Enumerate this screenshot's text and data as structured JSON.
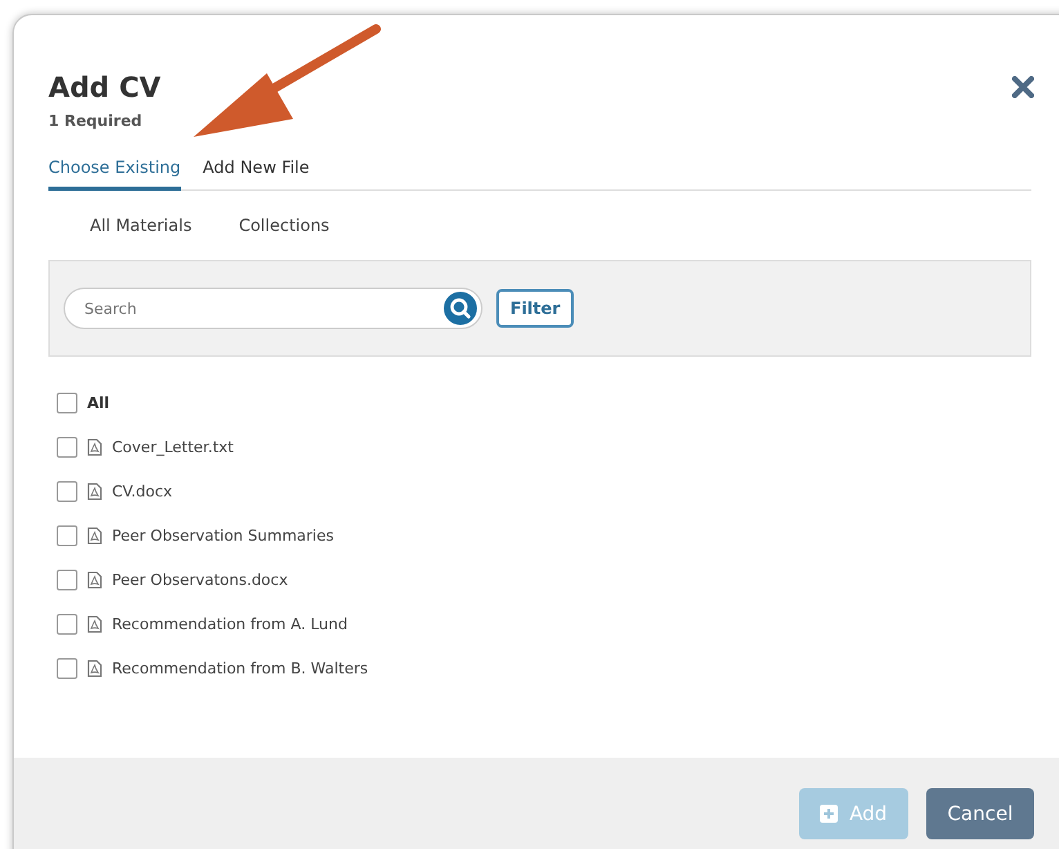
{
  "dialog": {
    "title": "Add CV",
    "subtitle": "1 Required"
  },
  "tabs": [
    {
      "label": "Choose Existing",
      "selected": true
    },
    {
      "label": "Add New File",
      "selected": false
    }
  ],
  "subtabs": [
    {
      "label": "All Materials"
    },
    {
      "label": "Collections"
    }
  ],
  "search": {
    "placeholder": "Search"
  },
  "filter_button": "Filter",
  "select_all": {
    "label": "All",
    "checked": false
  },
  "files": [
    {
      "name": "Cover_Letter.txt",
      "checked": false
    },
    {
      "name": "CV.docx",
      "checked": false
    },
    {
      "name": "Peer Observation Summaries",
      "checked": false
    },
    {
      "name": "Peer Observatons.docx",
      "checked": false
    },
    {
      "name": "Recommendation from A. Lund",
      "checked": false
    },
    {
      "name": "Recommendation from B. Walters",
      "checked": false
    }
  ],
  "footer": {
    "buttons": [
      {
        "label": "Add",
        "kind": "primary",
        "disabled": true
      },
      {
        "label": "Cancel",
        "kind": "secondary",
        "disabled": false
      }
    ]
  }
}
